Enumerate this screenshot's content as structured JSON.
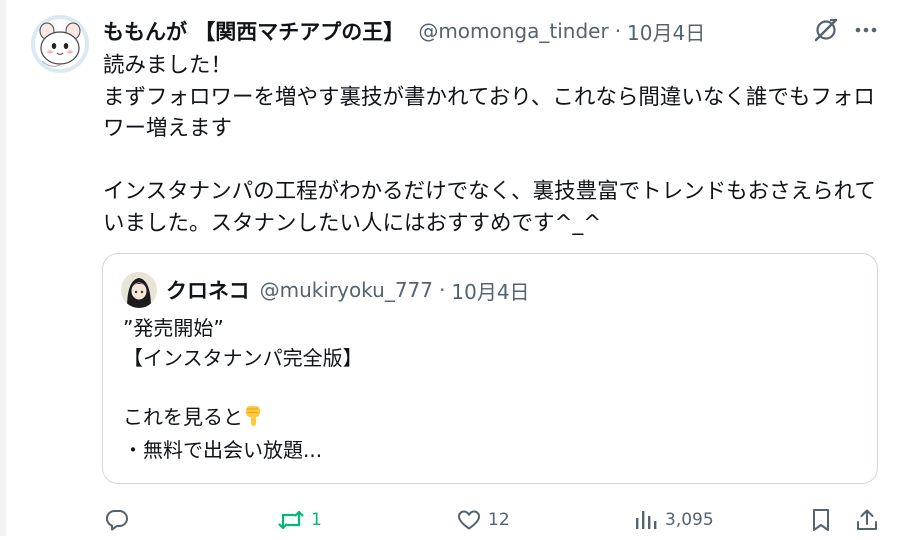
{
  "tweet": {
    "display_name": "ももんが 【関西マチアプの王】",
    "handle": "@momonga_tinder",
    "separator": "·",
    "date": "10月4日",
    "text": "読みました！\nまずフォロワーを増やす裏技が書かれており、これなら間違いなく誰でもフォロワー増えます\n\nインスタナンパの工程がわかるだけでなく、裏技豊富でトレンドもおさえられていました。スタナンしたい人にはおすすめです^_^"
  },
  "quote": {
    "display_name": "クロネコ",
    "handle": "@mukiryoku_777",
    "separator": "·",
    "date": "10月4日",
    "line1": "”発売開始”",
    "line2": "【インスタナンパ完全版】",
    "line3": "これを見ると",
    "line3_emoji": "backhand-index-pointing-down-emoji",
    "line4": "・無料で出会い放題..."
  },
  "actions": {
    "reply_icon": "reply-icon",
    "repost_icon": "repost-icon",
    "repost_count": "1",
    "like_icon": "heart-icon",
    "like_count": "12",
    "views_icon": "views-icon",
    "views_count": "3,095",
    "bookmark_icon": "bookmark-icon",
    "share_icon": "share-icon"
  },
  "colors": {
    "text": "#0f1419",
    "secondary": "#536471",
    "repost_green": "#00ba7c",
    "border": "#cfd9de"
  }
}
